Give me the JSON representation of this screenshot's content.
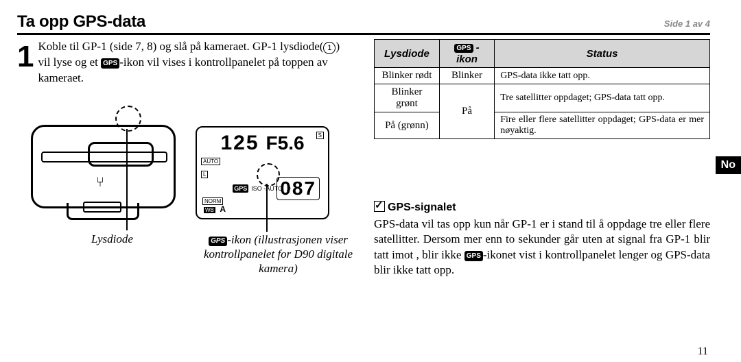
{
  "header": {
    "title": "Ta opp GPS-data",
    "page_of": "Side 1 av 4"
  },
  "step": {
    "number": "1",
    "text_a": "Koble til GP-1 (side 7, 8)  og slå på kameraet. GP-1 lysdiode(",
    "circled": "1",
    "text_b": ") vil lyse og et ",
    "gps_inline": "GPS",
    "text_c": "-ikon vil vises i kontroll­panelet på toppen av kameraet."
  },
  "diagram": {
    "lysdiode_caption": "Lysdiode",
    "usb_glyph": "⑂",
    "lcd": {
      "shutter": "125",
      "fstop": "F5.6",
      "auto": "AUTO",
      "l_tag": "L",
      "gps": "GPS",
      "iso_auto": "ISO  -AUTO",
      "note": "♪",
      "count": "087",
      "norm": "NORM",
      "wb": "WB",
      "a": "A",
      "s_tag": "S"
    },
    "lcd_caption_prefix_badge": "GPS",
    "lcd_caption": "-ikon (illustrasjonen viser kontrollpanelet for D90 digitale kamera)"
  },
  "table": {
    "head": {
      "c1": "Lysdiode",
      "c2_badge": "GPS",
      "c2_suffix": " -ikon",
      "c3": "Status"
    },
    "r1": {
      "lys": "Blinker rødt",
      "ikon": "Blinker",
      "status": "GPS-data ikke tatt opp."
    },
    "r2": {
      "lys": "Blinker grønt",
      "ikon": "På",
      "status": "Tre satellitter oppdaget; GPS-data tatt opp."
    },
    "r3": {
      "lys": "På (grønn)",
      "status": "Fire eller flere satellitter oppdaget; GPS-data er mer nøyaktig."
    }
  },
  "signal": {
    "heading": "GPS-signalet",
    "body_a": "GPS-data vil tas opp kun når GP-1 er i stand til å oppdage tre eller flere satellitter. Dersom mer enn to sekunder går uten at signal fra GP-1 blir tatt imot , blir ikke ",
    "badge": "GPS",
    "body_b": "-ikonet vist i kontrollpanelet lenger og GPS-data blir ikke tatt opp."
  },
  "side_tab": "No",
  "page_number": "11"
}
